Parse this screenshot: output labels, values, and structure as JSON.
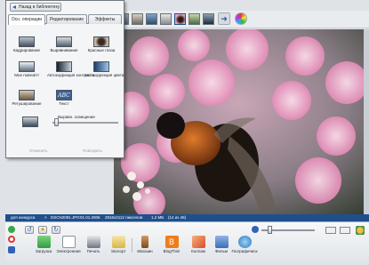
{
  "panel": {
    "back_label": "Назад в библиотеку",
    "tabs": [
      "Осн. операции",
      "Редактирование",
      "Эффекты"
    ],
    "tools": [
      {
        "label": "Кадрирование"
      },
      {
        "label": "Выравнивание"
      },
      {
        "label": "Красные глаза"
      },
      {
        "label": "Мне повезёт!"
      },
      {
        "label": "Автокоррекция контраста"
      },
      {
        "label": "Автокоррекция цвета"
      },
      {
        "label": "Ретуширование"
      },
      {
        "label": "Текст"
      }
    ],
    "slider_label": "Выравн. освещение",
    "slider_value_fraction": 0.03,
    "footer_left": "Отменить",
    "footer_right": "Повторить"
  },
  "info": {
    "album": "для конкурса",
    "filename": "DSCN2091.JPG",
    "date": "01.01.2006",
    "dimensions": "2816x2112 пикселов",
    "size": "1,2 МБ",
    "position": "(14 из 46)"
  },
  "dock": {
    "zoom_fraction": 0.12,
    "actions": [
      {
        "label": "Загрузка",
        "color": "#2f9e44"
      },
      {
        "label": "Электронная",
        "color": "#ffffff"
      },
      {
        "label": "Печать",
        "color": "#6f7680"
      },
      {
        "label": "Экспорт",
        "color": "#e8d27a"
      },
      {
        "label": "Магазин",
        "color": "#a46b35"
      },
      {
        "label": "BlogThis!",
        "color": "#ef7d1a"
      },
      {
        "label": "Коллаж",
        "color": "#d94b2f"
      },
      {
        "label": "Фильм",
        "color": "#3b6fb6"
      },
      {
        "label": "Географическ",
        "color": "#3a8cd4"
      }
    ]
  }
}
